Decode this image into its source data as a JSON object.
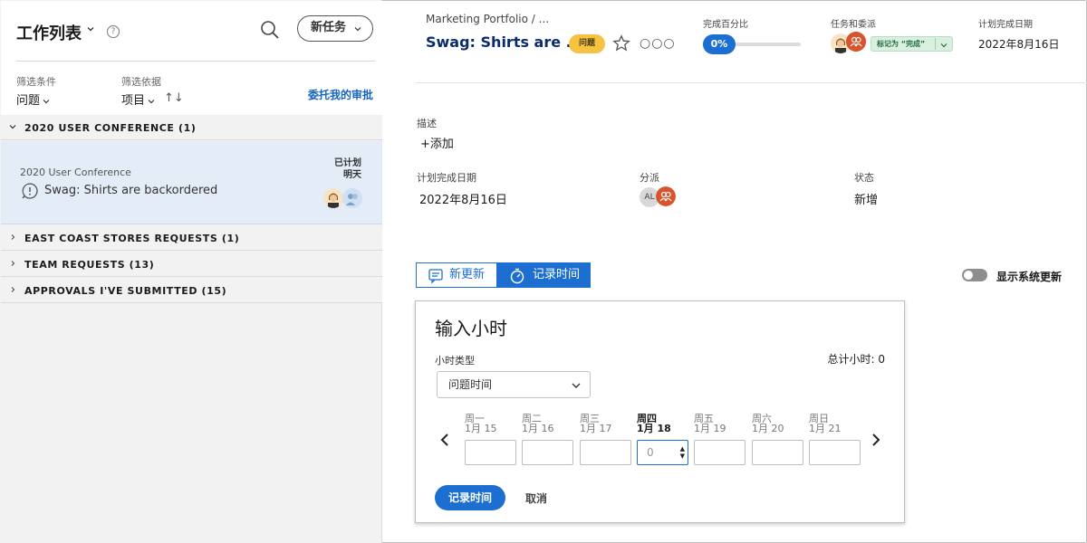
{
  "worklist": {
    "title": "工作列表",
    "new_task_label": "新任务",
    "filter_label": "筛选条件",
    "filter_value": "问题",
    "filterby_label": "筛选依据",
    "filterby_value": "项目",
    "delegated_link": "委托我的审批"
  },
  "groups": [
    {
      "name": "2020 USER CONFERENCE (1)",
      "expanded": true
    },
    {
      "name": "EAST COAST STORES  REQUESTS (1)",
      "expanded": false
    },
    {
      "name": "TEAM REQUESTS (13)",
      "expanded": false
    },
    {
      "name": "APPROVALS I'VE SUBMITTED (15)",
      "expanded": false
    }
  ],
  "work_item": {
    "project": "2020 User Conference",
    "name": "Swag: Shirts are backordered",
    "status_line1": "已计划",
    "status_line2": "明天"
  },
  "header": {
    "breadcrumb": "Marketing Portfolio  /  ...",
    "title": "Swag: Shirts are ...",
    "issue_badge": "问题",
    "percent_label": "完成百分比",
    "percent_value": "0%",
    "percent_complete": 0,
    "tasks_label": "任务和委派",
    "mark_done_label": "标记为 “完成”",
    "planned_label": "计划完成日期",
    "planned_value": "2022年8月16日"
  },
  "details": {
    "description_label": "描述",
    "add_label": "+添加",
    "planned_label": "计划完成日期",
    "planned_value": "2022年8月16日",
    "assigned_label": "分派",
    "assigned_initials": "AL",
    "status_label": "状态",
    "status_value": "新增"
  },
  "tabs": {
    "new_update": "新更新",
    "log_time": "记录时间",
    "show_system_updates": "显示系统更新"
  },
  "hours_form": {
    "title": "输入小时",
    "hour_type_label": "小时类型",
    "total_label": "总计小时: 0",
    "hour_type_value": "问题时间",
    "days": [
      {
        "name": "周一",
        "date": "1月 15",
        "value": ""
      },
      {
        "name": "周二",
        "date": "1月 16",
        "value": ""
      },
      {
        "name": "周三",
        "date": "1月 17",
        "value": ""
      },
      {
        "name": "周四",
        "date": "1月 18",
        "value": "",
        "placeholder": "0",
        "today": true
      },
      {
        "name": "周五",
        "date": "1月 19",
        "value": ""
      },
      {
        "name": "周六",
        "date": "1月 20",
        "value": ""
      },
      {
        "name": "周日",
        "date": "1月 21",
        "value": ""
      }
    ],
    "submit_label": "记录时间",
    "cancel_label": "取消"
  },
  "colors": {
    "accent": "#1c6fd0",
    "issue_badge": "#f5c242",
    "selected_row": "#e3ecf7",
    "done_badge": "#d9efdf"
  }
}
